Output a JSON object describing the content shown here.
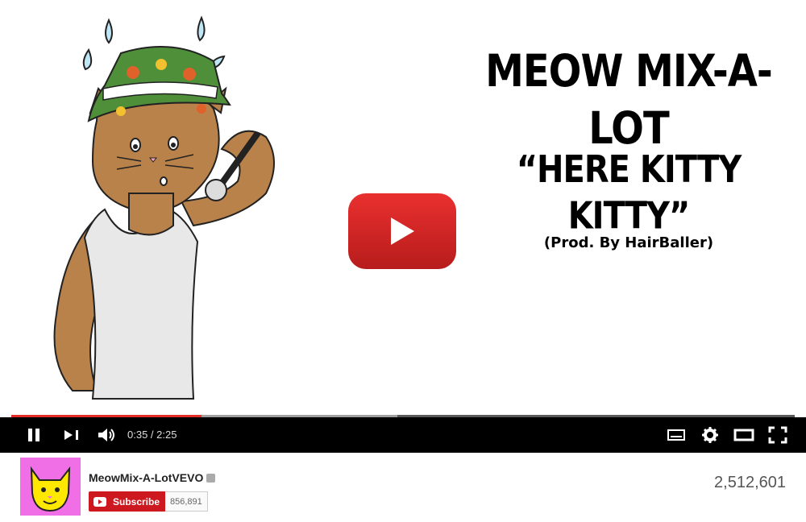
{
  "video": {
    "title_line1": "MEOW MIX-A-LOT",
    "title_line2": "“HERE KITTY KITTY”",
    "title_line3": "(Prod. By HairBaller)",
    "playback_fraction": 0.243,
    "buffered_fraction": 0.493
  },
  "player": {
    "time": "0:35 / 2:25"
  },
  "channel": {
    "name": "MeowMix-A-LotVEVO",
    "subscribe_label": "Subscribe",
    "subscriber_count": "856,891"
  },
  "stats": {
    "views": "2,512,601"
  },
  "colors": {
    "accent": "#e52d27",
    "subscribe": "#cc181e",
    "avatar_bg": "#f06fe6"
  }
}
